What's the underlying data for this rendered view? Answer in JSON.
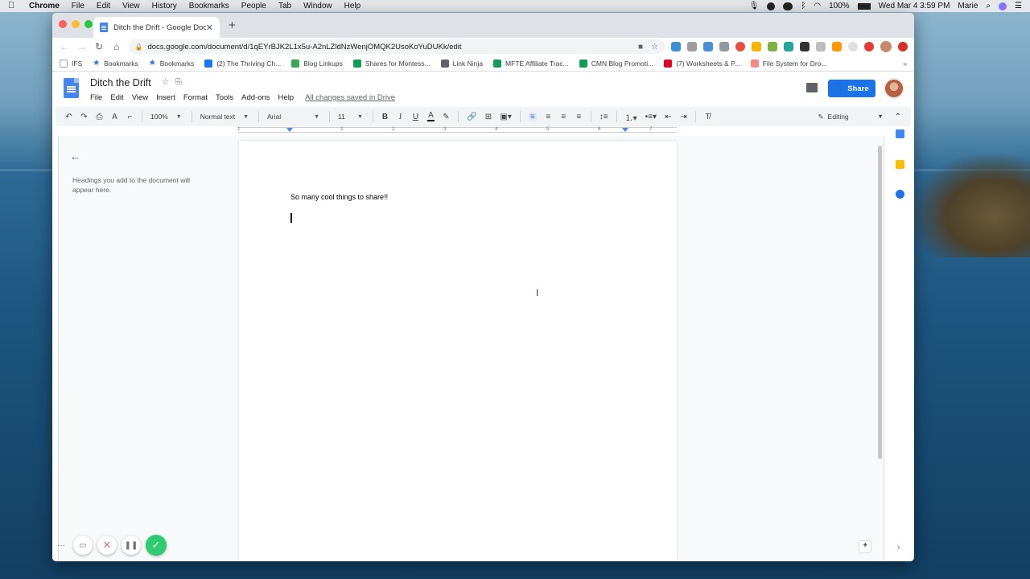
{
  "menubar": {
    "app": "Chrome",
    "items": [
      "File",
      "Edit",
      "View",
      "History",
      "Bookmarks",
      "People",
      "Tab",
      "Window",
      "Help"
    ],
    "battery": "100%",
    "datetime": "Wed Mar 4  3:59 PM",
    "user": "Marie"
  },
  "browser": {
    "tab_title": "Ditch the Drift - Google Docs",
    "tab_close": "✕",
    "new_tab": "+",
    "url": "docs.google.com/document/d/1qEYrBJK2L1x5u-A2nLZldNzWenjOMQK2UsoKoYuDUKk/edit",
    "bookmarks": [
      {
        "label": "IFS",
        "color": "#9aa0a6",
        "kind": "folder"
      },
      {
        "label": "Bookmarks",
        "color": "#1a73e8",
        "kind": "star"
      },
      {
        "label": "Bookmarks",
        "color": "#1a73e8",
        "kind": "star"
      },
      {
        "label": "(2) The Thriving Ch...",
        "color": "#1877f2",
        "kind": "icon"
      },
      {
        "label": "Blog Linkups",
        "color": "#34a853",
        "kind": "icon"
      },
      {
        "label": "Shares for Montess...",
        "color": "#0f9d58",
        "kind": "icon"
      },
      {
        "label": "Link Ninja",
        "color": "#5f6368",
        "kind": "icon"
      },
      {
        "label": "MFTE Affiliate Trac...",
        "color": "#0f9d58",
        "kind": "icon"
      },
      {
        "label": "CMN Blog Promoti...",
        "color": "#0f9d58",
        "kind": "icon"
      },
      {
        "label": "(7) Worksheets & P...",
        "color": "#e60023",
        "kind": "icon"
      },
      {
        "label": "File System for Dro...",
        "color": "#f28b82",
        "kind": "icon"
      }
    ],
    "bookmarks_more": "»"
  },
  "docs": {
    "title": "Ditch the Drift",
    "menu": [
      "File",
      "Edit",
      "View",
      "Insert",
      "Format",
      "Tools",
      "Add-ons",
      "Help"
    ],
    "saved_status": "All changes saved in Drive",
    "share_label": "Share",
    "toolbar": {
      "zoom": "100%",
      "style": "Normal text",
      "font": "Arial",
      "font_size": "11",
      "mode": "Editing"
    },
    "ruler_numbers": [
      "1",
      "1",
      "2",
      "3",
      "4",
      "5",
      "6",
      "7"
    ],
    "outline_text": "Headings you add to the document will appear here.",
    "body_text": "So many cool things to share!!"
  },
  "colors": {
    "accent": "#1a73e8",
    "docs_blue": "#4285f4",
    "confirm_green": "#2ecc71"
  }
}
